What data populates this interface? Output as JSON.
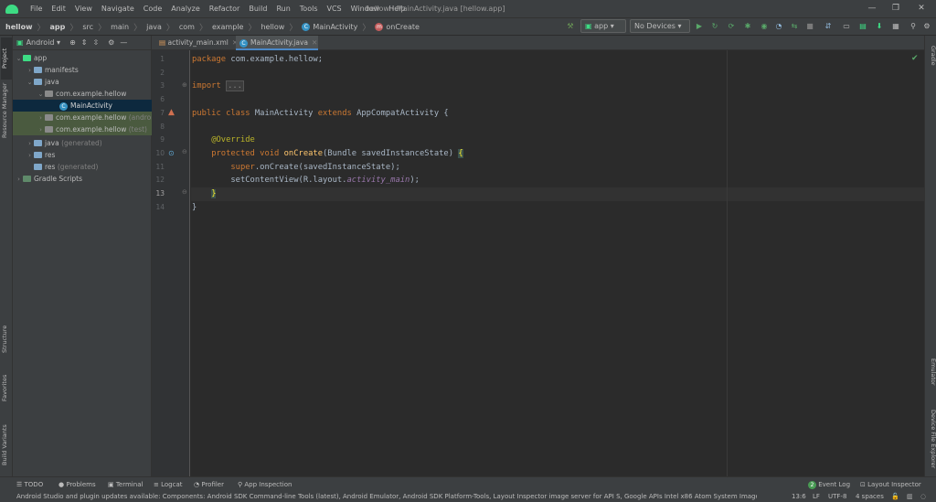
{
  "menu": {
    "items": [
      "File",
      "Edit",
      "View",
      "Navigate",
      "Code",
      "Analyze",
      "Refactor",
      "Build",
      "Run",
      "Tools",
      "VCS",
      "Window",
      "Help"
    ],
    "window_title": "hellow - MainActivity.java [hellow.app]"
  },
  "breadcrumbs": {
    "items": [
      "hellow",
      "app",
      "src",
      "main",
      "java",
      "com",
      "example",
      "hellow",
      "MainActivity",
      "onCreate"
    ]
  },
  "toolbar": {
    "run_config": "app",
    "device": "No Devices"
  },
  "project_panel": {
    "view_mode": "Android",
    "tree": [
      {
        "label": "app"
      },
      {
        "label": "manifests"
      },
      {
        "label": "java"
      },
      {
        "label": "com.example.hellow"
      },
      {
        "label": "MainActivity"
      },
      {
        "label": "com.example.hellow",
        "suffix": "(androi"
      },
      {
        "label": "com.example.hellow",
        "suffix": "(test)"
      },
      {
        "label": "java",
        "suffix": "(generated)"
      },
      {
        "label": "res"
      },
      {
        "label": "res",
        "suffix": "(generated)"
      },
      {
        "label": "Gradle Scripts"
      }
    ]
  },
  "left_tool_tabs": [
    "Project",
    "Resource Manager",
    "Structure",
    "Favorites",
    "Build Variants"
  ],
  "right_tool_tabs": [
    "Gradle",
    "Emulator",
    "Device File Explorer"
  ],
  "editor": {
    "tabs": [
      {
        "label": "activity_main.xml"
      },
      {
        "label": "MainActivity.java"
      }
    ],
    "line_numbers": [
      "1",
      "2",
      "3",
      "6",
      "7",
      "8",
      "9",
      "10",
      "11",
      "12",
      "13",
      "14"
    ],
    "code": {
      "l1_kw": "package",
      "l1_rest": " com.example.hellow;",
      "l3_kw": "import",
      "l3_fold": "...",
      "l7_kw1": "public",
      "l7_kw2": "class",
      "l7_name": " MainActivity ",
      "l7_kw3": "extends",
      "l7_rest": " AppCompatActivity {",
      "l9_ann": "@Override",
      "l10_kw1": "protected",
      "l10_kw2": "void",
      "l10_fn": "onCreate",
      "l10_rest": "(Bundle savedInstanceState) ",
      "l10_brace": "{",
      "l11_kw": "super",
      "l11_rest": ".onCreate(savedInstanceState);",
      "l12_a": "setContentView(R.layout.",
      "l12_it": "activity_main",
      "l12_b": ");",
      "l13_brace": "}",
      "l14": "}"
    }
  },
  "bottom_tabs": [
    "TODO",
    "Problems",
    "Terminal",
    "Logcat",
    "Profiler",
    "App Inspection"
  ],
  "bottom_right_tabs": {
    "event_log_count": "2",
    "event_log": "Event Log",
    "layout_inspector": "Layout Inspector"
  },
  "status": {
    "message": "Android Studio and plugin updates available: Components: Android SDK Command-line Tools (latest), Android Emulator, Android SDK Platform-Tools, Layout Inspector image server for API S, Google APIs Intel x86 Atom System Image... (mc",
    "position": "13:6",
    "line_sep": "LF",
    "encoding": "UTF-8",
    "indent": "4 spaces"
  }
}
